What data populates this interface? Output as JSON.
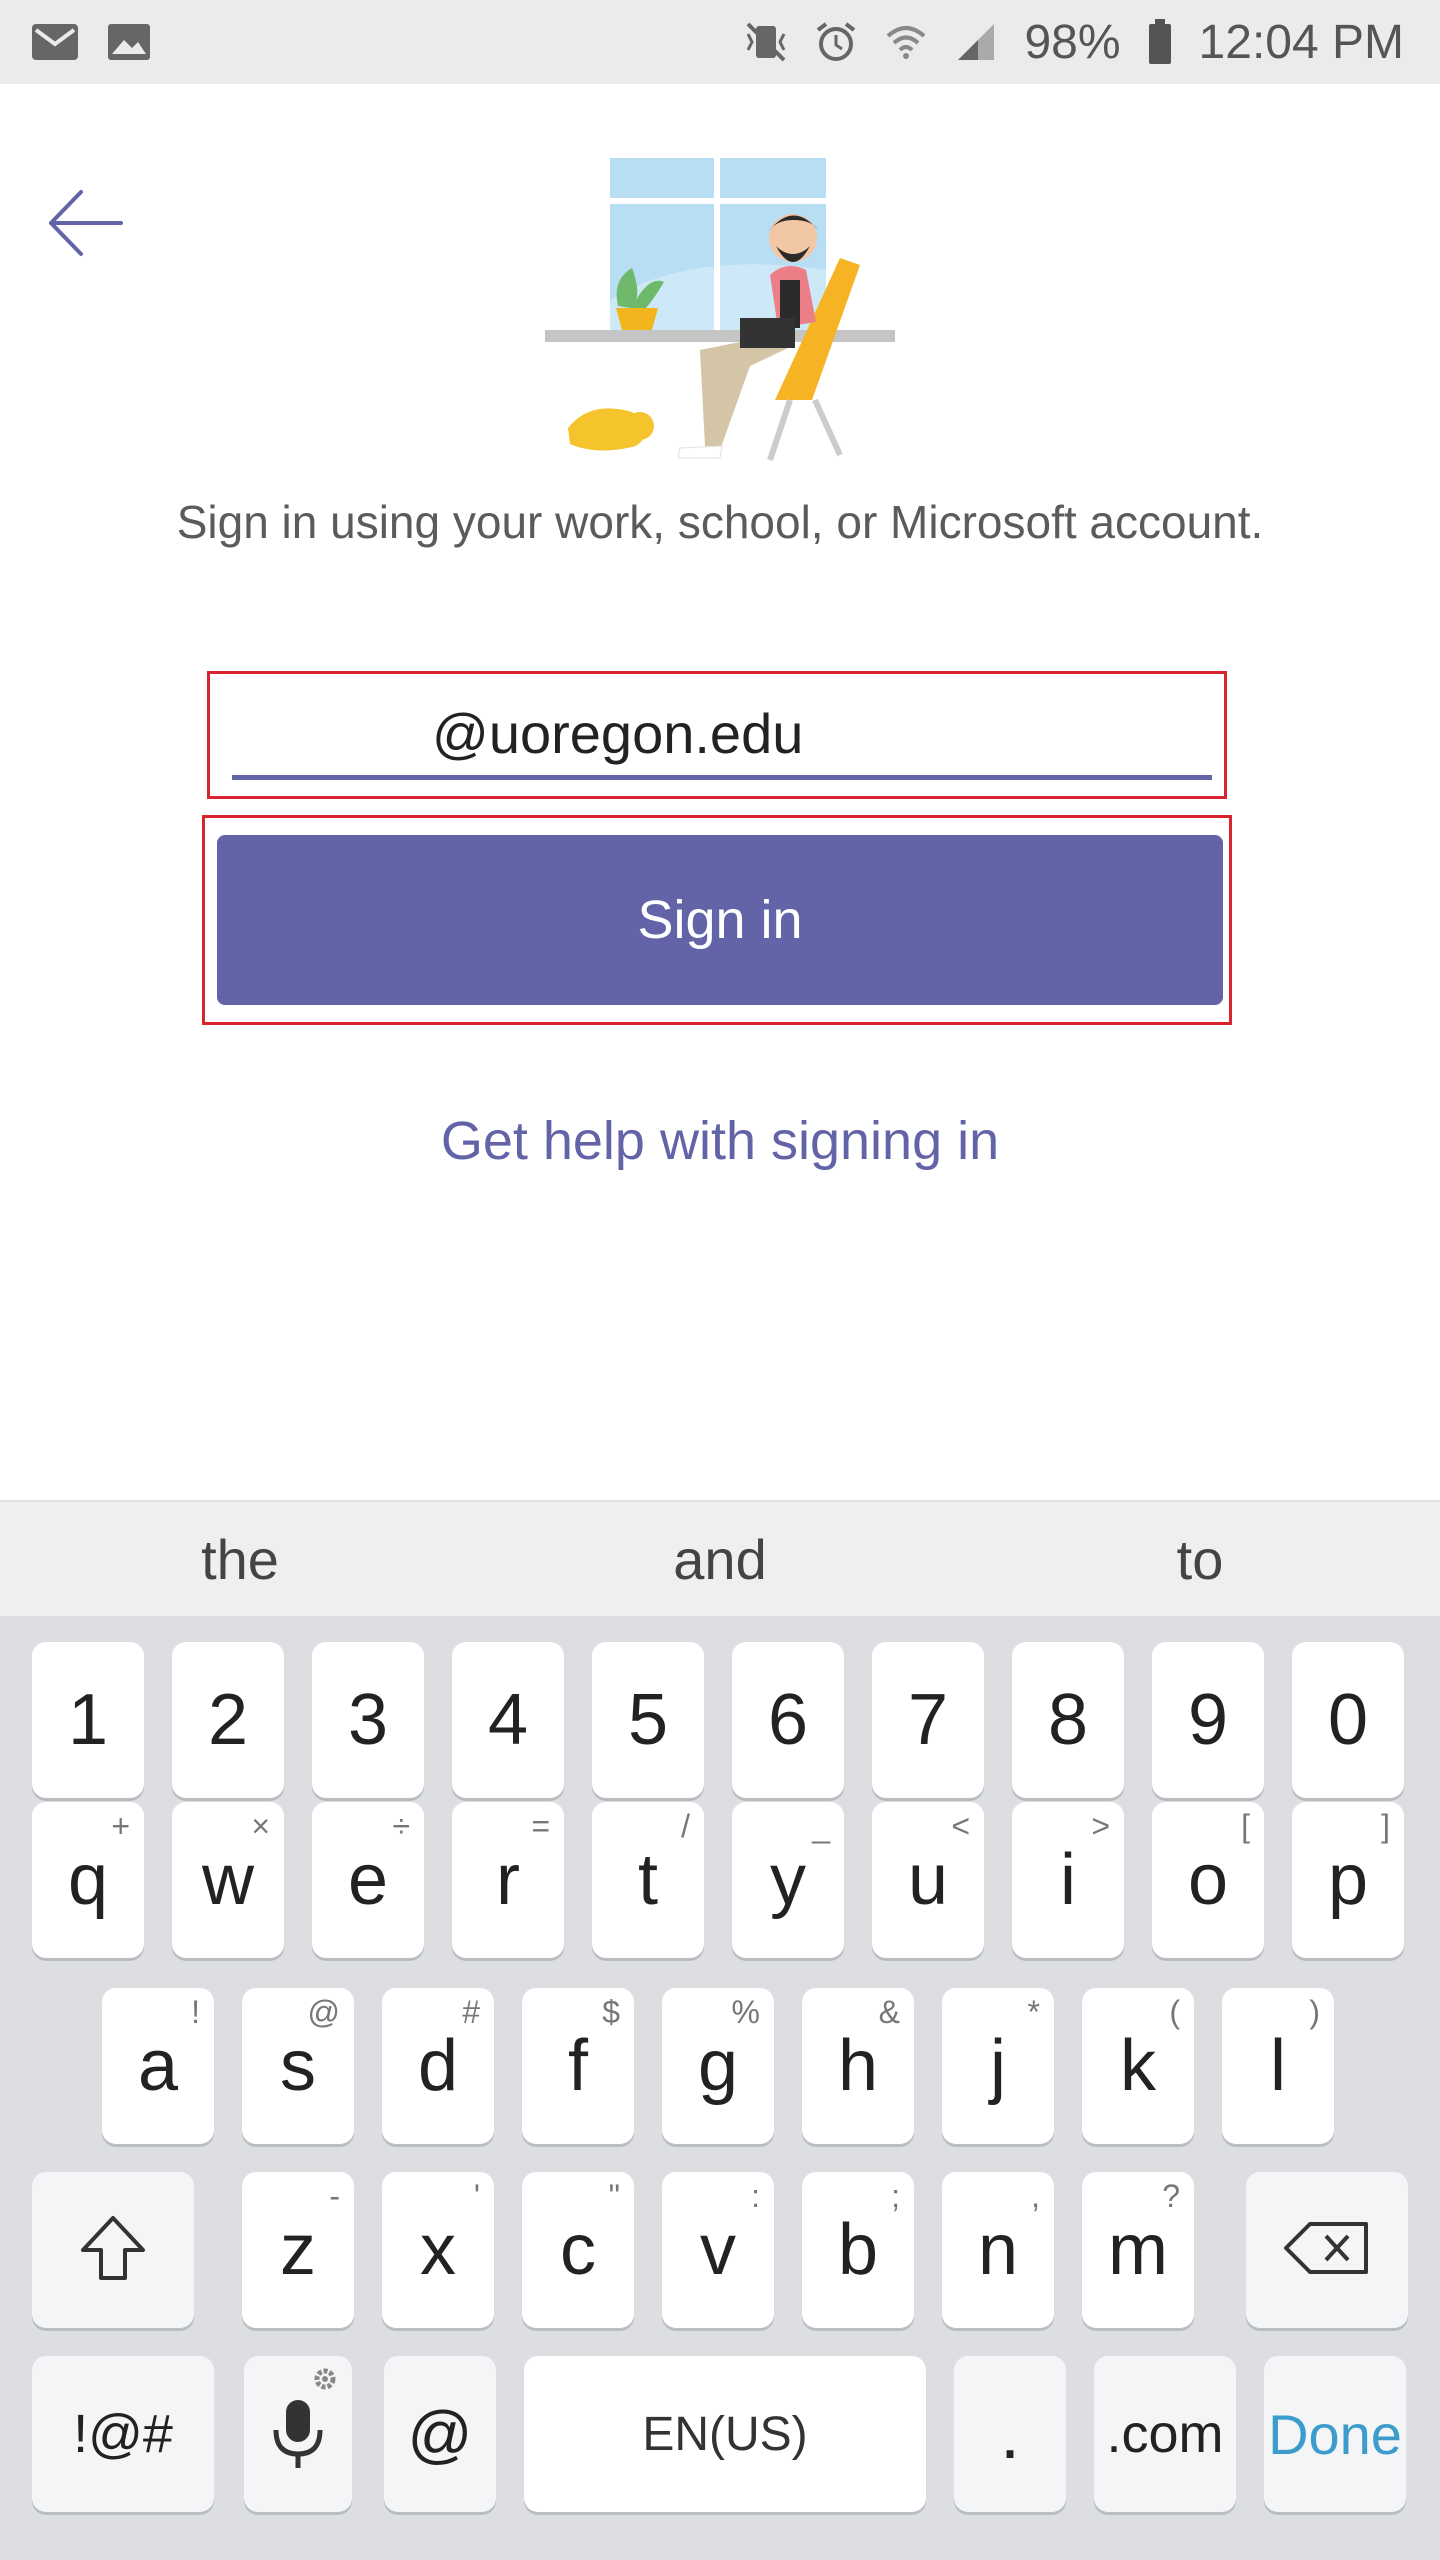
{
  "status_bar": {
    "battery": "98%",
    "time": "12:04 PM",
    "icons": [
      "mail-icon",
      "image-icon",
      "vibrate-icon",
      "alarm-icon",
      "wifi-icon",
      "signal-icon",
      "battery-icon"
    ]
  },
  "header": {
    "back_icon": "arrow-left-icon"
  },
  "prompt": "Sign in using your work, school, or Microsoft account.",
  "email": {
    "value": "@uoregon.edu",
    "placeholder": ""
  },
  "signin_label": "Sign in",
  "help_link": "Get help with signing in",
  "keyboard": {
    "suggestions": [
      "the",
      "and",
      "to"
    ],
    "numbers": [
      "1",
      "2",
      "3",
      "4",
      "5",
      "6",
      "7",
      "8",
      "9",
      "0"
    ],
    "row1": [
      {
        "k": "q",
        "a": "+"
      },
      {
        "k": "w",
        "a": "×"
      },
      {
        "k": "e",
        "a": "÷"
      },
      {
        "k": "r",
        "a": "="
      },
      {
        "k": "t",
        "a": "/"
      },
      {
        "k": "y",
        "a": "_"
      },
      {
        "k": "u",
        "a": "<"
      },
      {
        "k": "i",
        "a": ">"
      },
      {
        "k": "o",
        "a": "["
      },
      {
        "k": "p",
        "a": "]"
      }
    ],
    "row2": [
      {
        "k": "a",
        "a": "!"
      },
      {
        "k": "s",
        "a": "@"
      },
      {
        "k": "d",
        "a": "#"
      },
      {
        "k": "f",
        "a": "$"
      },
      {
        "k": "g",
        "a": "%"
      },
      {
        "k": "h",
        "a": "&"
      },
      {
        "k": "j",
        "a": "*"
      },
      {
        "k": "k",
        "a": "("
      },
      {
        "k": "l",
        "a": ")"
      }
    ],
    "row3": [
      {
        "k": "z",
        "a": "-"
      },
      {
        "k": "x",
        "a": "'"
      },
      {
        "k": "c",
        "a": "\""
      },
      {
        "k": "v",
        "a": ":"
      },
      {
        "k": "b",
        "a": ";"
      },
      {
        "k": "n",
        "a": ","
      },
      {
        "k": "m",
        "a": "?"
      }
    ],
    "symbols_label": "!@#",
    "at_label": "@",
    "space_label": "EN(US)",
    "period_label": ".",
    "dotcom_label": ".com",
    "done_label": "Done"
  },
  "colors": {
    "accent": "#6264a7",
    "highlight": "#d9232e",
    "done": "#3c9ccc"
  }
}
